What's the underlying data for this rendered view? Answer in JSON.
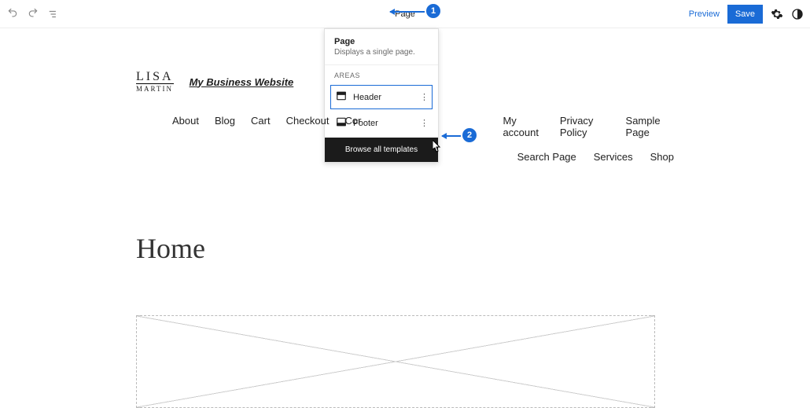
{
  "topbar": {
    "center_label": "Page",
    "preview_label": "Preview",
    "save_label": "Save"
  },
  "dropdown": {
    "title": "Page",
    "description": "Displays a single page.",
    "areas_label": "AREAS",
    "items": [
      {
        "label": "Header",
        "selected": true
      },
      {
        "label": "Footer",
        "selected": false
      }
    ],
    "browse_all_label": "Browse all templates"
  },
  "annotations": {
    "badge1": "1",
    "badge2": "2"
  },
  "site": {
    "logo_line1": "LISA",
    "logo_line2": "MARTIN",
    "title": "My Business Website",
    "nav": [
      "About",
      "Blog",
      "Cart",
      "Checkout",
      "Cor",
      "My account",
      "Privacy Policy",
      "Sample Page",
      "Search Page",
      "Services",
      "Shop"
    ],
    "page_title": "Home"
  }
}
